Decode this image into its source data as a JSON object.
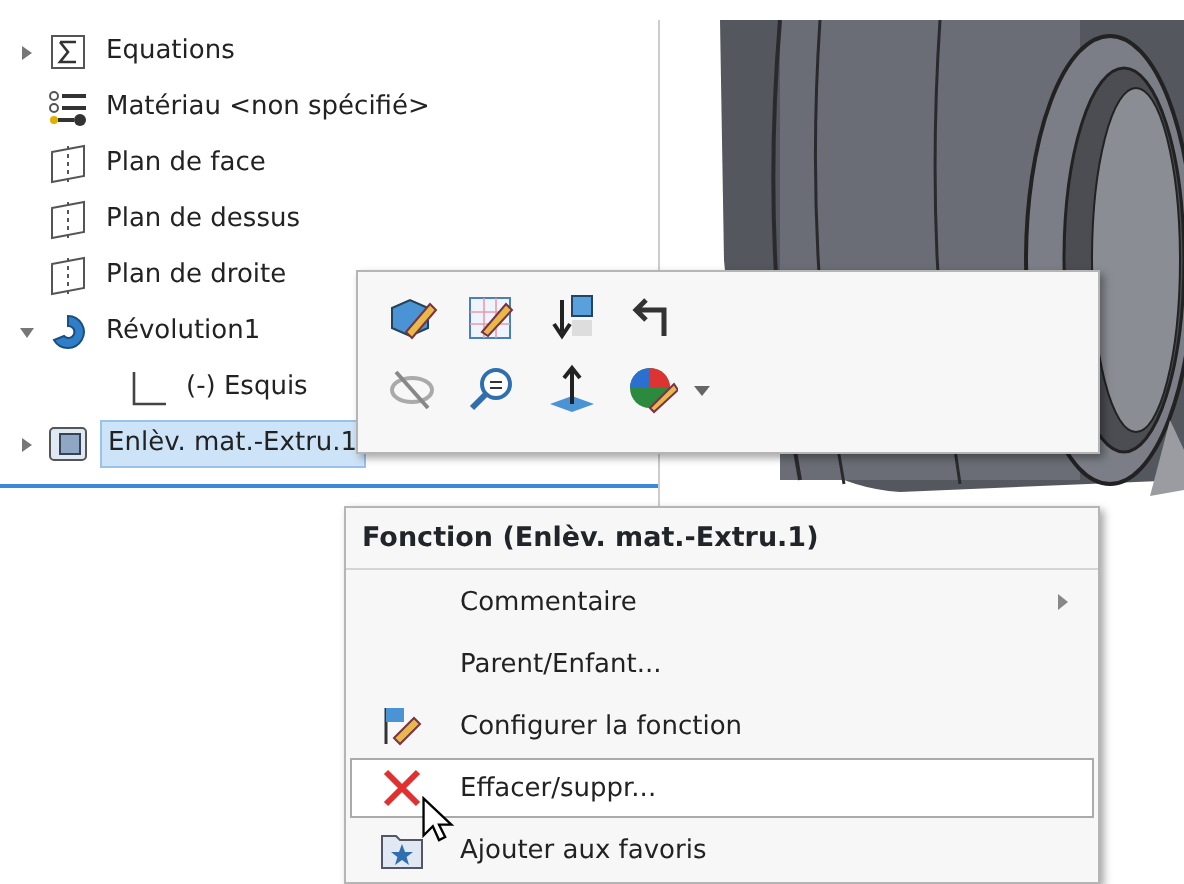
{
  "tree": [
    {
      "label": "Equations",
      "kind": "equations",
      "expanded": false,
      "selected": false
    },
    {
      "label": "Matériau <non spécifié>",
      "kind": "material",
      "selected": false
    },
    {
      "label": "Plan de face",
      "kind": "plane",
      "selected": false
    },
    {
      "label": "Plan de dessus",
      "kind": "plane",
      "selected": false
    },
    {
      "label": "Plan de droite",
      "kind": "plane",
      "selected": false
    },
    {
      "label": "Révolution1",
      "kind": "revolve",
      "expanded": true,
      "selected": false,
      "children": [
        {
          "label": "(-) Esquis",
          "kind": "sketch",
          "selected": false
        }
      ]
    },
    {
      "label": "Enlèv. mat.-Extru.1",
      "kind": "cut",
      "expanded": false,
      "selected": true
    }
  ],
  "toolbar": {
    "rows": [
      [
        {
          "kind": "edit"
        },
        {
          "kind": "sketch"
        },
        {
          "kind": "rollback"
        },
        {
          "kind": "parent"
        }
      ],
      [
        {
          "kind": "hide"
        },
        {
          "kind": "zoom"
        },
        {
          "kind": "normal"
        },
        {
          "kind": "appearance"
        }
      ]
    ],
    "dropdown": true
  },
  "context_menu": {
    "title": "Fonction (Enlèv. mat.-Extru.1)",
    "items": [
      {
        "label": "Commentaire",
        "submenu": true,
        "hovered": false
      },
      {
        "label": "Parent/Enfant...",
        "submenu": false,
        "hovered": false
      },
      {
        "label": "Configurer la fonction",
        "kind": "configure",
        "submenu": false,
        "hovered": false
      },
      {
        "label": "Effacer/suppr...",
        "kind": "delete",
        "submenu": false,
        "hovered": true
      },
      {
        "label": "Ajouter aux favoris",
        "kind": "favorite",
        "submenu": false,
        "hovered": false
      }
    ]
  }
}
